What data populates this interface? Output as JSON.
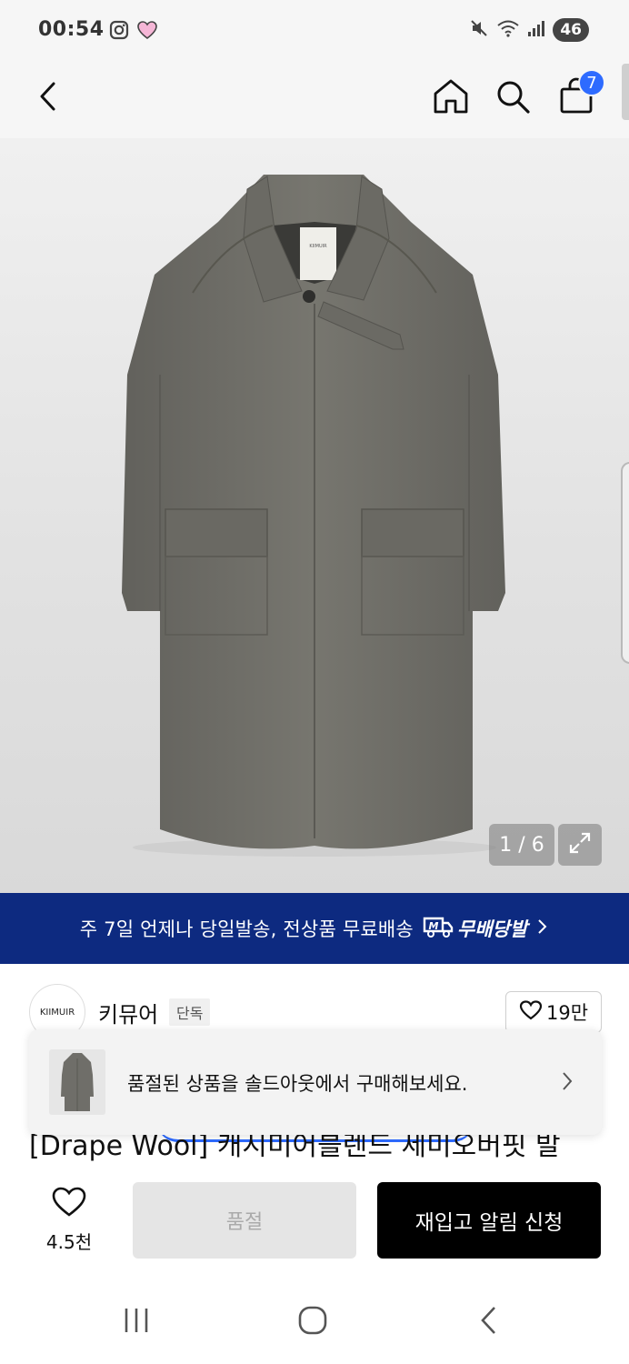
{
  "status_bar": {
    "time": "00:54",
    "battery": "46",
    "left_icons": [
      "instagram-icon",
      "heart-icon"
    ],
    "right_icons": [
      "mute-icon",
      "wifi-icon",
      "signal-icon"
    ]
  },
  "nav": {
    "cart_count": "7",
    "icons": [
      "back-icon",
      "home-icon",
      "search-icon",
      "shopping-bag-icon"
    ]
  },
  "gallery": {
    "counter": "1 / 6",
    "product_label_text": "KIIMUIR"
  },
  "shipping_banner": {
    "text": "주 7일 언제나 당일발송, 전상품 무료배송",
    "brand": "무배당발",
    "brand_icon": "M"
  },
  "brand": {
    "logo_text": "KIIMUIR",
    "name": "키뮤어",
    "tag": "단독",
    "likes": "19만"
  },
  "soldout_popup": {
    "text": "품절된 상품을 솔드아웃에서 구매해보세요."
  },
  "product": {
    "title_partial": "[Drape Wool] 캐시미어블렌드 세미오버핏 발"
  },
  "bottom_bar": {
    "wish_count": "4.5천",
    "soldout_label": "품절",
    "restock_label": "재입고 알림 신청"
  },
  "colors": {
    "banner": "#0d2a80",
    "badge": "#2e6bff",
    "coat": "#6f6e69"
  }
}
